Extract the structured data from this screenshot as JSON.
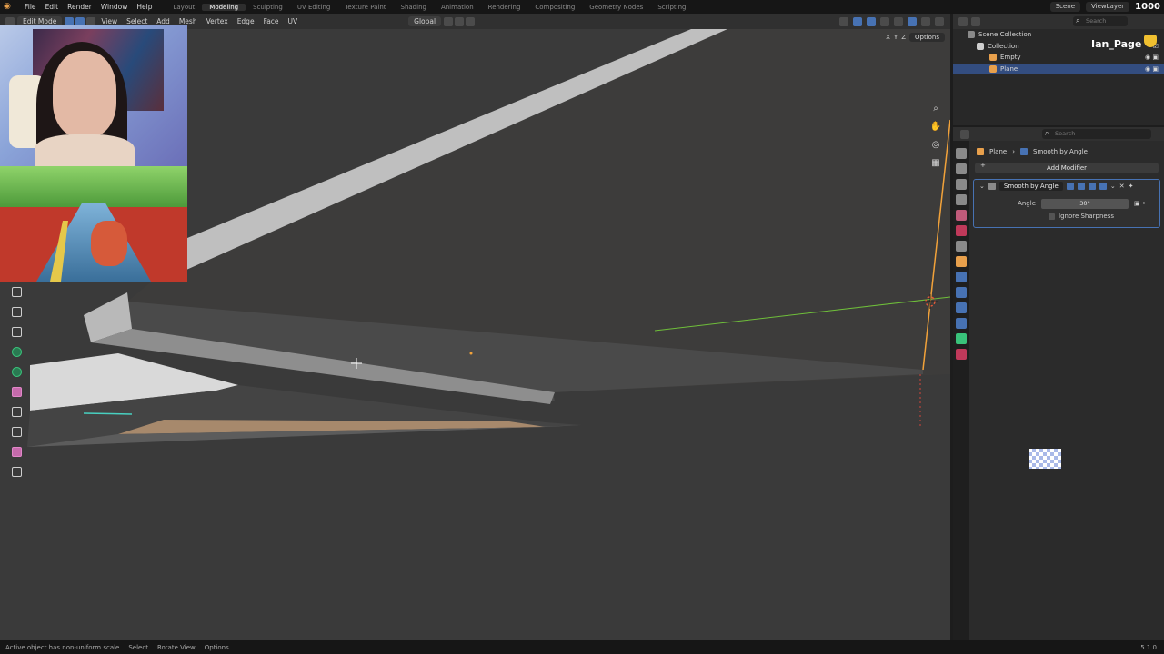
{
  "topbar": {
    "menus": [
      "File",
      "Edit",
      "Render",
      "Window",
      "Help"
    ],
    "workspaces": [
      "Layout",
      "Modeling",
      "Sculpting",
      "UV Editing",
      "Texture Paint",
      "Shading",
      "Animation",
      "Rendering",
      "Compositing",
      "Geometry Nodes",
      "Scripting"
    ],
    "active_workspace": "Modeling",
    "scene": "Scene",
    "view_layer": "ViewLayer",
    "counter": "1000"
  },
  "viewport_header": {
    "mode": "Edit Mode",
    "menus": [
      "View",
      "Select",
      "Add",
      "Mesh",
      "Vertex",
      "Edge",
      "Face",
      "UV"
    ],
    "transform_orientation": "Global",
    "axes": [
      "X",
      "Y",
      "Z"
    ],
    "options": "Options"
  },
  "outliner": {
    "search_placeholder": "Search",
    "rows": [
      {
        "label": "Scene Collection"
      },
      {
        "label": "Collection"
      },
      {
        "label": "Empty"
      },
      {
        "label": "Plane"
      }
    ]
  },
  "overlay": {
    "username": "Ian_Page"
  },
  "properties": {
    "search_placeholder": "Search",
    "breadcrumb_object": "Plane",
    "breadcrumb_modifier": "Smooth by Angle",
    "add_modifier_label": "Add Modifier",
    "modifier_name": "Smooth by Angle",
    "angle_label": "Angle",
    "angle_value": "30°",
    "ignore_sharpness_label": "Ignore Sharpness"
  },
  "statusbar": {
    "message": "Active object has non-uniform scale",
    "hints": [
      "Select",
      "Rotate View",
      "Options"
    ],
    "version": "5.1.0"
  },
  "colors": {
    "accent_blue": "#4772b3",
    "selection_orange": "#f2a23a",
    "axis_green": "#6fbf3a",
    "axis_red": "#d0463c"
  }
}
